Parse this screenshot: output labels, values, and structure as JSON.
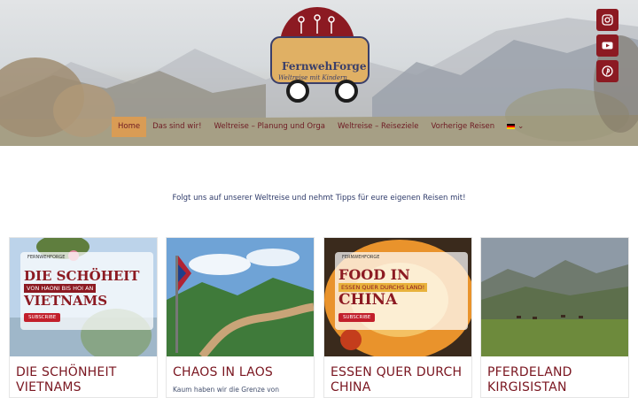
{
  "logo": {
    "name": "FernwehForge",
    "slogan": "Weltreise mit Kindern"
  },
  "social": [
    {
      "icon": "instagram-icon",
      "label": "Instagram"
    },
    {
      "icon": "youtube-icon",
      "label": "YouTube"
    },
    {
      "icon": "pinterest-icon",
      "label": "Pinterest"
    }
  ],
  "nav": {
    "items": [
      "Home",
      "Das sind wir!",
      "Weltreise – Planung und Orga",
      "Weltreise – Reiseziele",
      "Vorherige Reisen"
    ],
    "active": "Home",
    "language_icon": "german-flag-icon"
  },
  "tagline": "Folgt uns auf unserer Weltreise und nehmt Tipps für eure eigenen Reisen mit!",
  "cards": [
    {
      "title": "Die Schönheit Vietnams",
      "excerpt": "",
      "image": {
        "brand": "FERNWEHFORGE",
        "headline_1": "DIE SCHÖHEIT",
        "subline": "VON HAONI BIS HOI AN",
        "headline_2": "VIETNAMS",
        "button": "SUBSCRIBE"
      }
    },
    {
      "title": "Chaos in Laos",
      "excerpt": "Kaum haben wir die Grenze von",
      "image": {}
    },
    {
      "title": "Essen quer durch China",
      "excerpt": "",
      "image": {
        "brand": "FERNWEHFORGE",
        "headline_1": "FOOD IN",
        "subline": "ESSEN QUER DURCHS LAND!",
        "headline_2": "CHINA",
        "button": "SUBSCRIBE"
      }
    },
    {
      "title": "Pferdeland Kirgisistan",
      "excerpt": "",
      "image": {}
    }
  ],
  "colors": {
    "brand_red": "#8c1a22",
    "nav_active_bg": "#d99c55",
    "title_red": "#7a1620",
    "tagline_blue": "#2f3b6a"
  }
}
